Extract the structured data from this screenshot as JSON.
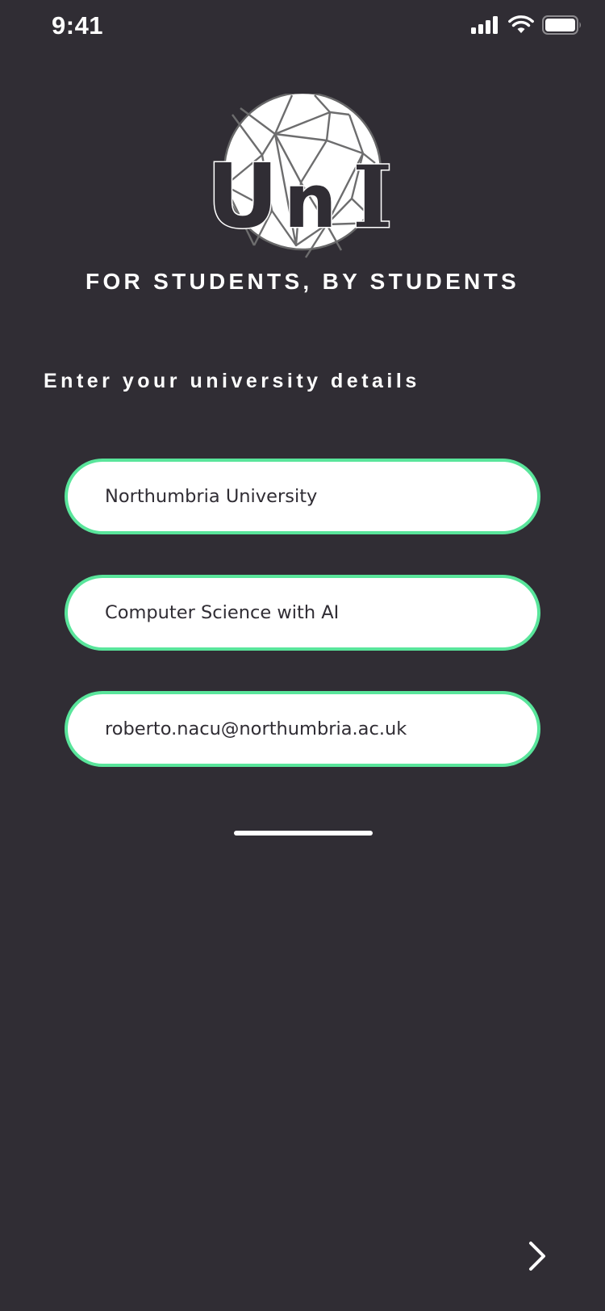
{
  "status_bar": {
    "time": "9:41",
    "icons": [
      "signal-icon",
      "wifi-icon",
      "battery-icon"
    ]
  },
  "logo": {
    "text_u": "U",
    "text_n": "n",
    "text_i": "I"
  },
  "tagline": "FOR STUDENTS, BY STUDENTS",
  "form": {
    "heading": "Enter your university details",
    "university": {
      "value": "Northumbria University"
    },
    "course": {
      "value": "Computer Science with AI"
    },
    "email": {
      "value": "roberto.nacu@northumbria.ac.uk"
    }
  },
  "navigation": {
    "next_icon": "chevron-right-icon"
  },
  "colors": {
    "background": "#302d34",
    "accent": "#59e59b",
    "field_background": "#ffffff",
    "text_light": "#ffffff",
    "text_dark": "#302d34"
  }
}
